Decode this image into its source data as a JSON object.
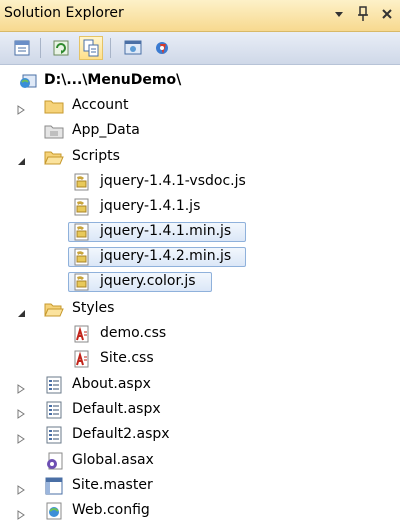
{
  "window": {
    "title": "Solution Explorer",
    "controls": [
      "dropdown-icon",
      "pin-icon",
      "close-icon"
    ]
  },
  "toolbar": {
    "buttons": [
      "properties-icon",
      "refresh-icon",
      "nest-related-files-icon",
      "view-in-browser-icon",
      "asp-net-configuration-icon"
    ]
  },
  "tree": {
    "root": {
      "label": "D:\\...\\MenuDemo\\",
      "icon": "website-icon"
    },
    "items": [
      {
        "label": "Account",
        "icon": "folder-icon",
        "expander": "collapsed"
      },
      {
        "label": "App_Data",
        "icon": "app-data-folder-icon",
        "expander": "none"
      },
      {
        "label": "Scripts",
        "icon": "open-folder-icon",
        "expander": "expanded"
      },
      {
        "label": "jquery-1.4.1-vsdoc.js",
        "icon": "javascript-file-icon",
        "selected": false
      },
      {
        "label": "jquery-1.4.1.js",
        "icon": "javascript-file-icon",
        "selected": false
      },
      {
        "label": "jquery-1.4.1.min.js",
        "icon": "javascript-file-icon",
        "selected": true
      },
      {
        "label": "jquery-1.4.2.min.js",
        "icon": "javascript-file-icon",
        "selected": true
      },
      {
        "label": "jquery.color.js",
        "icon": "javascript-file-icon",
        "selected": true
      },
      {
        "label": "Styles",
        "icon": "open-folder-icon",
        "expander": "expanded"
      },
      {
        "label": "demo.css",
        "icon": "css-file-icon"
      },
      {
        "label": "Site.css",
        "icon": "css-file-icon"
      },
      {
        "label": "About.aspx",
        "icon": "aspx-file-icon",
        "expander": "collapsed"
      },
      {
        "label": "Default.aspx",
        "icon": "aspx-file-icon",
        "expander": "collapsed"
      },
      {
        "label": "Default2.aspx",
        "icon": "aspx-file-icon",
        "expander": "collapsed"
      },
      {
        "label": "Global.asax",
        "icon": "global-asax-icon",
        "expander": "none"
      },
      {
        "label": "Site.master",
        "icon": "master-page-icon",
        "expander": "collapsed"
      },
      {
        "label": "Web.config",
        "icon": "config-file-icon",
        "expander": "collapsed"
      }
    ]
  }
}
